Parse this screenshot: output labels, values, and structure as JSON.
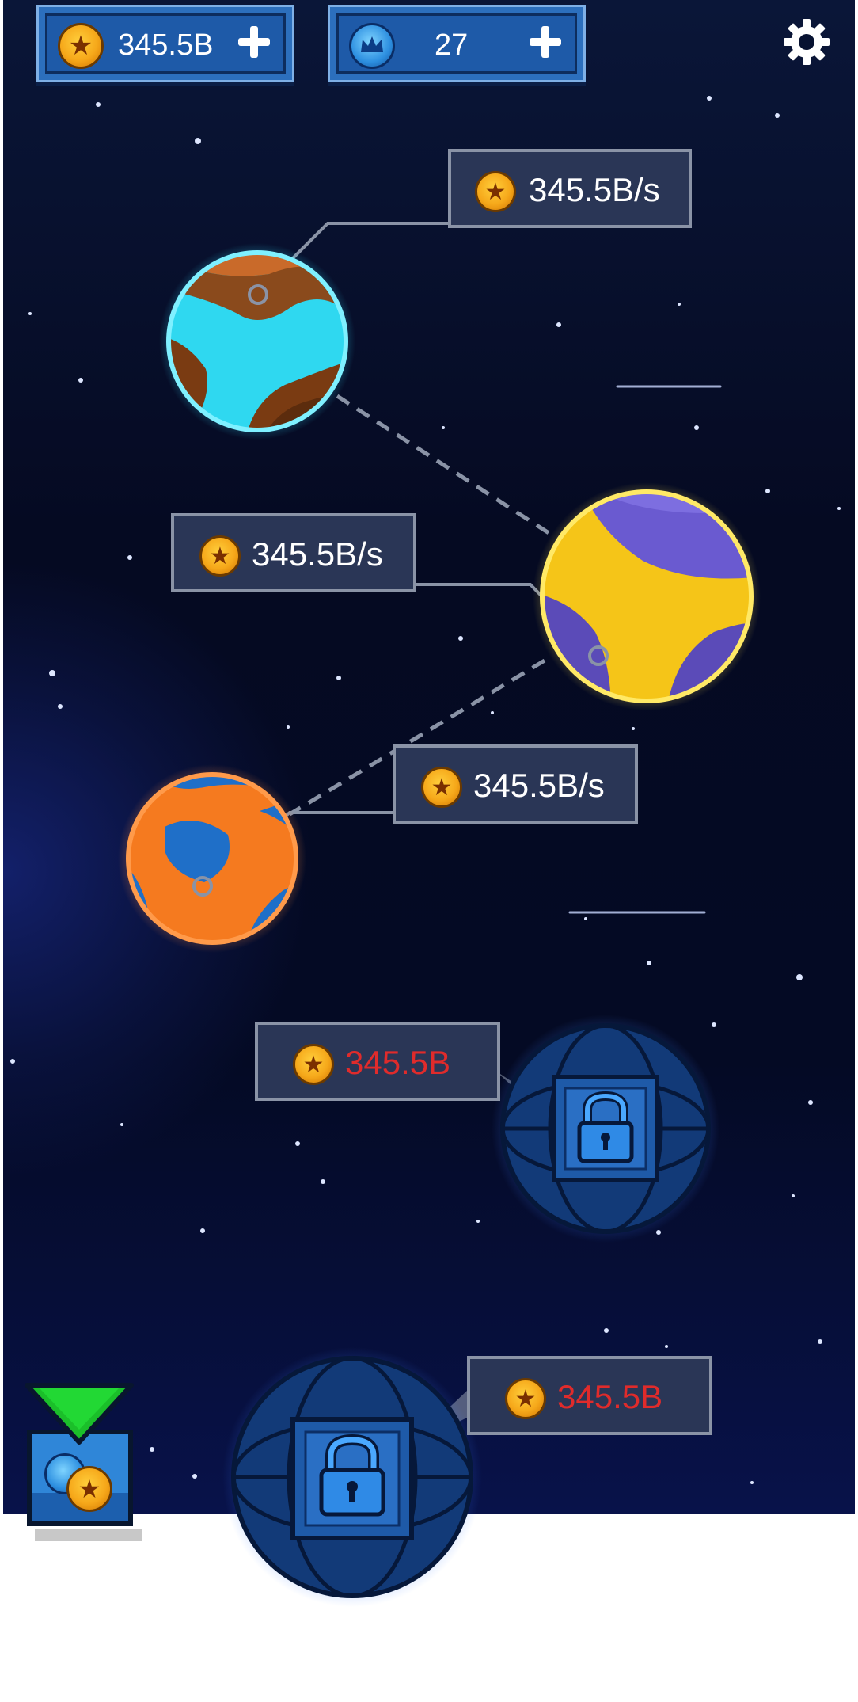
{
  "hud": {
    "coins": {
      "value": "345.5B",
      "icon": "coin-icon",
      "add_icon": "plus-icon"
    },
    "crowns": {
      "value": "27",
      "icon": "crown-icon",
      "add_icon": "plus-icon"
    },
    "settings_icon": "gear-icon"
  },
  "planets": [
    {
      "rate": "345.5B/s",
      "state": "unlocked",
      "colors": [
        "#2fd8f0",
        "#7a3b12"
      ]
    },
    {
      "rate": "345.5B/s",
      "state": "unlocked",
      "colors": [
        "#f5c518",
        "#5b4bb8"
      ]
    },
    {
      "rate": "345.5B/s",
      "state": "unlocked",
      "colors": [
        "#f57a1f",
        "#1f6fc8"
      ]
    },
    {
      "cost": "345.5B",
      "state": "locked"
    },
    {
      "cost": "345.5B",
      "state": "locked"
    }
  ],
  "chest": {
    "icon": "chest-icon",
    "arrow_icon": "green-arrow-icon"
  },
  "colors": {
    "locked_cost": "#e02b2b",
    "label_bg": "#2a3656",
    "hud_blue": "#2c6fbd"
  }
}
